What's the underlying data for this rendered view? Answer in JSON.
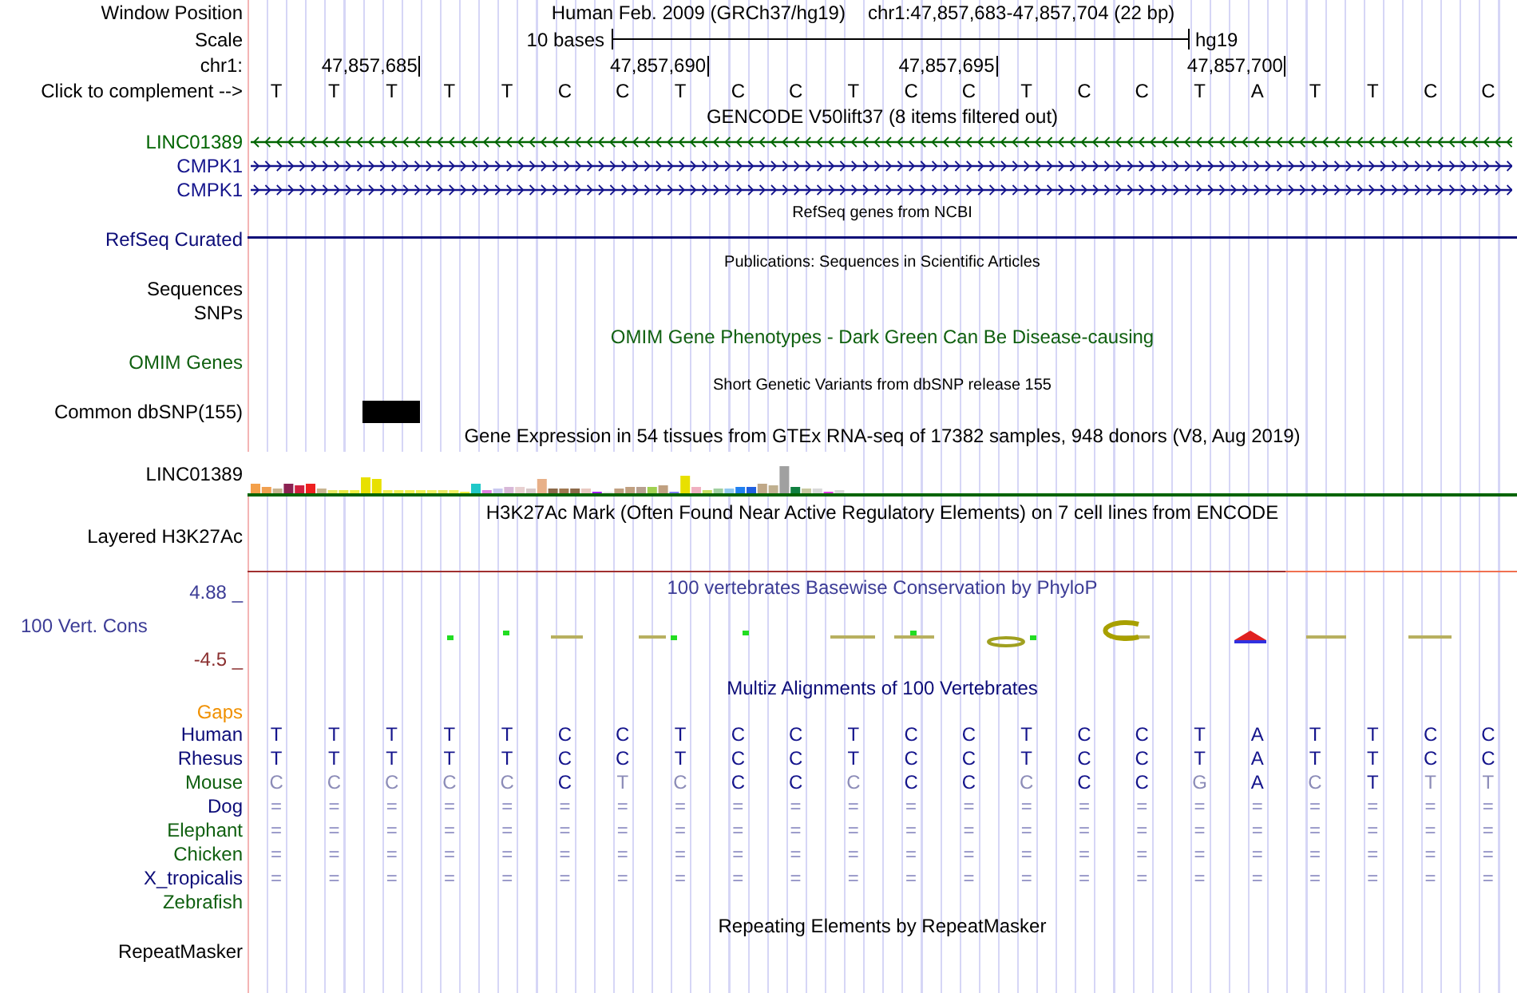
{
  "header": {
    "window_label": "Window Position",
    "assembly_title": "Human Feb. 2009 (GRCh37/hg19)",
    "region": "chr1:47,857,683-47,857,704 (22 bp)",
    "scale_label": "Scale",
    "scale_text": "10 bases",
    "assembly": "hg19",
    "chrom_label": "chr1:",
    "ticks": [
      "47,857,685",
      "47,857,690",
      "47,857,695",
      "47,857,700"
    ],
    "complement_label": "Click to complement -->",
    "bases": [
      "T",
      "T",
      "T",
      "T",
      "T",
      "C",
      "C",
      "T",
      "C",
      "C",
      "T",
      "C",
      "C",
      "T",
      "C",
      "C",
      "T",
      "A",
      "T",
      "T",
      "C",
      "C"
    ]
  },
  "tracks": [
    {
      "kind": "title",
      "text": "GENCODE V50lift37 (8 items filtered out)",
      "color": "#000000"
    },
    {
      "kind": "gene",
      "label": "LINC01389",
      "reverse_strand": true,
      "color": "#006400"
    },
    {
      "kind": "gene",
      "label": "CMPK1",
      "reverse_strand": false,
      "color": "#14148c"
    },
    {
      "kind": "gene",
      "label": "CMPK1",
      "reverse_strand": false,
      "color": "#14148c"
    },
    {
      "kind": "subtitle",
      "text": "RefSeq genes from NCBI"
    },
    {
      "kind": "line",
      "label": "RefSeq Curated",
      "color": "#0c0c78"
    },
    {
      "kind": "subtitle",
      "text": "Publications: Sequences in Scientific Articles"
    },
    {
      "kind": "empty",
      "label": "Sequences",
      "color": "#000000"
    },
    {
      "kind": "empty",
      "label": "SNPs",
      "color": "#000000"
    },
    {
      "kind": "title",
      "text": "OMIM Gene Phenotypes - Dark Green Can Be Disease-causing",
      "color": "#106010"
    },
    {
      "kind": "empty",
      "label": "OMIM Genes",
      "color": "#106010"
    },
    {
      "kind": "subtitle",
      "text": "Short Genetic Variants from dbSNP release 155"
    },
    {
      "kind": "snp",
      "label": "Common dbSNP(155)",
      "color": "#000000"
    },
    {
      "kind": "title",
      "text": "Gene Expression in 54 tissues from GTEx RNA-seq of 17382 samples, 948 donors (V8, Aug 2019)",
      "color": "#000000"
    },
    {
      "kind": "expression",
      "label": "LINC01389",
      "color": "#000000"
    },
    {
      "kind": "title",
      "text": "H3K27Ac Mark (Often Found Near Active Regulatory Elements) on 7 cell lines from ENCODE",
      "color": "#000000"
    },
    {
      "kind": "signal",
      "label": "Layered H3K27Ac",
      "color": "#000000"
    },
    {
      "kind": "conservation",
      "label": "100 Vert. Cons",
      "title": "100 vertebrates Basewise Conservation by PhyloP",
      "max": "4.88 _",
      "min": "-4.5 _",
      "color": "#3c3c96"
    },
    {
      "kind": "title",
      "text": "Multiz Alignments of 100 Vertebrates",
      "color": "#0c0c78"
    },
    {
      "kind": "species",
      "label": "Gaps",
      "color": "#f09000"
    },
    {
      "kind": "species",
      "label": "Human",
      "color": "#0c0c78",
      "bases": [
        "T",
        "T",
        "T",
        "T",
        "T",
        "C",
        "C",
        "T",
        "C",
        "C",
        "T",
        "C",
        "C",
        "T",
        "C",
        "C",
        "T",
        "A",
        "T",
        "T",
        "C",
        "C"
      ]
    },
    {
      "kind": "species",
      "label": "Rhesus",
      "color": "#0c0c78",
      "bases": [
        "T",
        "T",
        "T",
        "T",
        "T",
        "C",
        "C",
        "T",
        "C",
        "C",
        "T",
        "C",
        "C",
        "T",
        "C",
        "C",
        "T",
        "A",
        "T",
        "T",
        "C",
        "C"
      ]
    },
    {
      "kind": "species",
      "label": "Mouse",
      "color": "#106010",
      "bases": [
        "C",
        "C",
        "C",
        "C",
        "C",
        "C",
        "T",
        "C",
        "C",
        "C",
        "C",
        "C",
        "C",
        "C",
        "C",
        "C",
        "G",
        "A",
        "C",
        "T",
        "T",
        "T"
      ],
      "faded": [
        true,
        true,
        true,
        true,
        true,
        false,
        true,
        true,
        false,
        false,
        true,
        false,
        false,
        true,
        false,
        false,
        true,
        false,
        true,
        false,
        true,
        true
      ]
    },
    {
      "kind": "species",
      "label": "Dog",
      "color": "#0c0c78",
      "bases": [
        "=",
        "=",
        "=",
        "=",
        "=",
        "=",
        "=",
        "=",
        "=",
        "=",
        "=",
        "=",
        "=",
        "=",
        "=",
        "=",
        "=",
        "=",
        "=",
        "=",
        "=",
        "="
      ]
    },
    {
      "kind": "species",
      "label": "Elephant",
      "color": "#106010",
      "bases": [
        "=",
        "=",
        "=",
        "=",
        "=",
        "=",
        "=",
        "=",
        "=",
        "=",
        "=",
        "=",
        "=",
        "=",
        "=",
        "=",
        "=",
        "=",
        "=",
        "=",
        "=",
        "="
      ]
    },
    {
      "kind": "species",
      "label": "Chicken",
      "color": "#106010",
      "bases": [
        "=",
        "=",
        "=",
        "=",
        "=",
        "=",
        "=",
        "=",
        "=",
        "=",
        "=",
        "=",
        "=",
        "=",
        "=",
        "=",
        "=",
        "=",
        "=",
        "=",
        "=",
        "="
      ]
    },
    {
      "kind": "species",
      "label": "X_tropicalis",
      "color": "#0c0c78",
      "bases": [
        "=",
        "=",
        "=",
        "=",
        "=",
        "=",
        "=",
        "=",
        "=",
        "=",
        "=",
        "=",
        "=",
        "=",
        "=",
        "=",
        "=",
        "=",
        "=",
        "=",
        "=",
        "="
      ]
    },
    {
      "kind": "species",
      "label": "Zebrafish",
      "color": "#106010"
    },
    {
      "kind": "title",
      "text": "Repeating Elements by RepeatMasker",
      "color": "#000000"
    },
    {
      "kind": "empty",
      "label": "RepeatMasker",
      "color": "#000000"
    }
  ]
}
